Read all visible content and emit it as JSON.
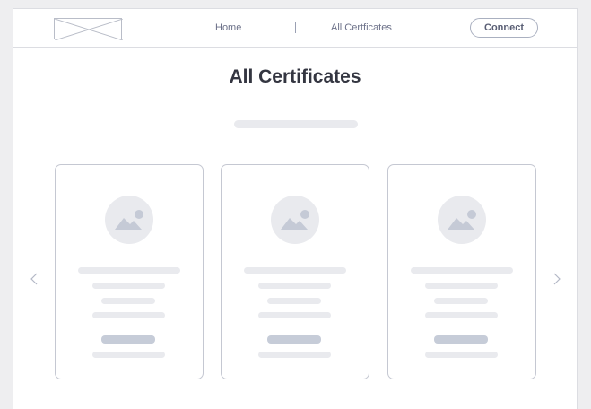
{
  "nav": {
    "home_label": "Home",
    "certificates_label": "All Certficates",
    "connect_label": "Connect"
  },
  "page": {
    "title": "All Certificates"
  },
  "carousel": {
    "card_count": 3,
    "prev_icon": "chevron-left-icon",
    "next_icon": "chevron-right-icon",
    "card_image_icon": "image-placeholder-icon"
  },
  "colors": {
    "background": "#eeeef0",
    "frame": "#ffffff",
    "border": "#dcdde2",
    "nav_text": "#6c7189",
    "title_text": "#343641",
    "placeholder": "#e9eaee",
    "placeholder_dark": "#c6ccd8",
    "icon": "#c5cad6"
  }
}
